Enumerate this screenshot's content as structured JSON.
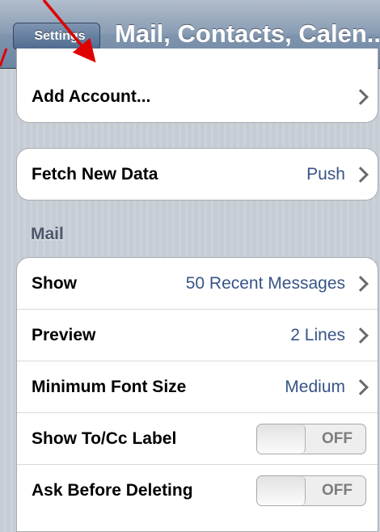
{
  "nav": {
    "back_label": "Settings",
    "title": "Mail, Contacts, Calen..."
  },
  "accounts": {
    "add_account": "Add Account..."
  },
  "fetch": {
    "label": "Fetch New Data",
    "value": "Push"
  },
  "mail": {
    "header": "Mail",
    "rows": [
      {
        "label": "Show",
        "value": "50 Recent Messages"
      },
      {
        "label": "Preview",
        "value": "2 Lines"
      },
      {
        "label": "Minimum Font Size",
        "value": "Medium"
      }
    ],
    "toggles": [
      {
        "label": "Show To/Cc Label",
        "state": "OFF"
      },
      {
        "label": "Ask Before Deleting",
        "state": "OFF"
      }
    ]
  },
  "colors": {
    "annotation_arrow": "#e00000",
    "value_blue": "#385487"
  }
}
